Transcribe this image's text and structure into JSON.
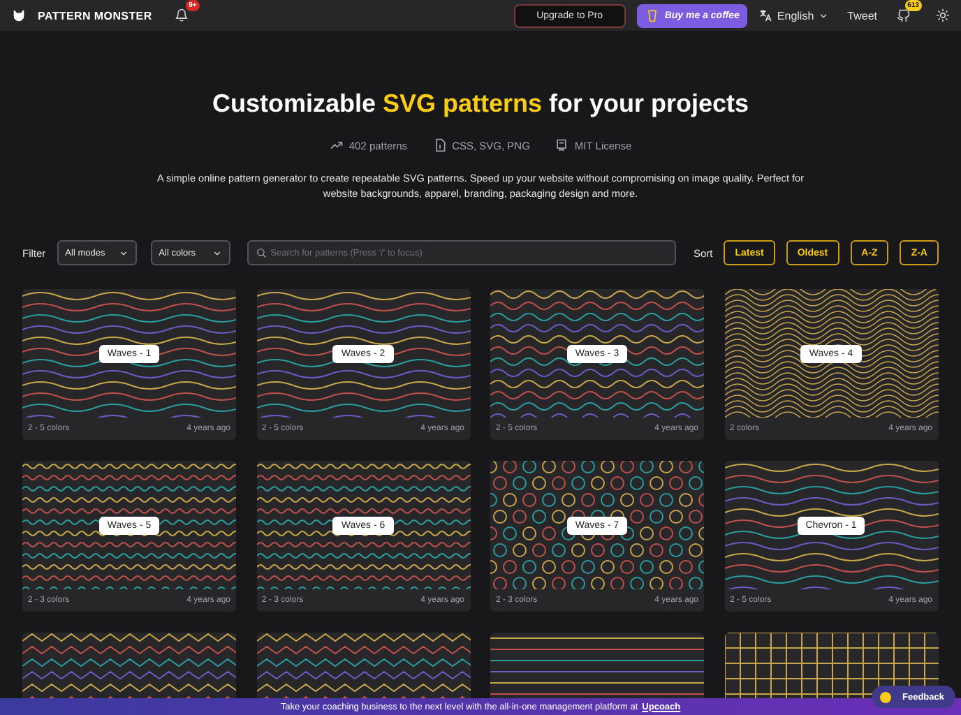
{
  "header": {
    "brand": "PATTERN MONSTER",
    "notification_badge": "9+",
    "upgrade_button": "Upgrade to Pro",
    "coffee_button": "Buy me a coffee",
    "language": "English",
    "tweet": "Tweet",
    "github_badge": "613"
  },
  "hero": {
    "title": "Customizable **SVG patterns** for your projects",
    "stats": [
      {
        "kind": "trend",
        "label": "402 patterns"
      },
      {
        "kind": "file",
        "label": "CSS, SVG, PNG"
      },
      {
        "kind": "license",
        "label": "MIT License"
      }
    ],
    "description": "A simple online pattern generator to create repeatable SVG patterns. Speed up your website without compromising on image quality. Perfect for website backgrounds, apparel, branding, packaging design and more."
  },
  "filter": {
    "label": "Filter",
    "modes": "All modes",
    "colors": "All colors",
    "search_placeholder": "Search for patterns (Press '/' to focus)",
    "sort_label": "Sort",
    "sort_options": [
      {
        "label": "Latest",
        "selected": false
      },
      {
        "label": "Oldest",
        "selected": false
      },
      {
        "label": "A-Z",
        "selected": false
      },
      {
        "label": "Z-A",
        "selected": false
      }
    ]
  },
  "patterns": [
    {
      "kind": "waves",
      "name": "Waves - 1",
      "colors": "2 - 5 colors",
      "age": "4 years ago"
    },
    {
      "kind": "waves",
      "name": "Waves - 2",
      "colors": "2 - 5 colors",
      "age": "4 years ago"
    },
    {
      "kind": "ripple",
      "name": "Waves - 3",
      "colors": "2 - 5 colors",
      "age": "4 years ago"
    },
    {
      "kind": "dense",
      "name": "Waves - 4",
      "colors": "2 colors",
      "age": "4 years ago"
    },
    {
      "kind": "scallop",
      "name": "Waves - 5",
      "colors": "2 - 3 colors",
      "age": "4 years ago"
    },
    {
      "kind": "scallop",
      "name": "Waves - 6",
      "colors": "2 - 3 colors",
      "age": "4 years ago"
    },
    {
      "kind": "spiral",
      "name": "Waves - 7",
      "colors": "2 - 3 colors",
      "age": "4 years ago"
    },
    {
      "kind": "waves",
      "name": "Chevron - 1",
      "colors": "2 - 5 colors",
      "age": "4 years ago"
    },
    {
      "kind": "zigzag"
    },
    {
      "kind": "zigzag"
    },
    {
      "kind": "stripes"
    },
    {
      "kind": "grid"
    }
  ],
  "banner": {
    "text": "Take your coaching business to the next level with the all-in-one management platform at",
    "link": "Upcoach"
  },
  "feedback": "Feedback"
}
